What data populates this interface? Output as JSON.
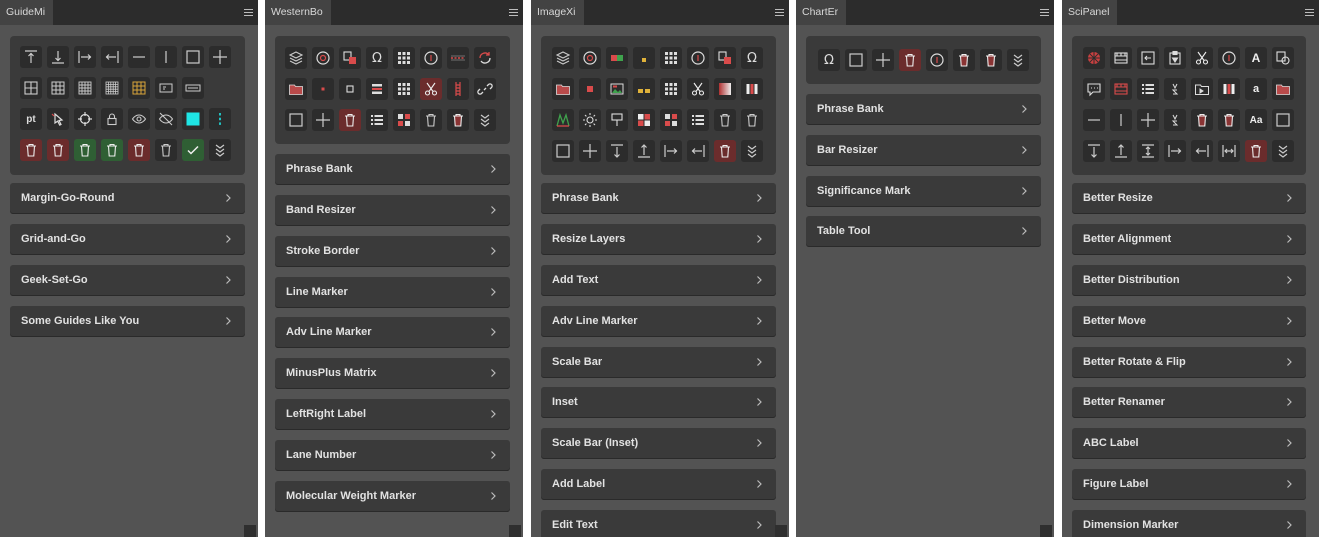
{
  "colors": {
    "panel_bg": "#535353",
    "titlebar_bg": "#2c2c2c",
    "tab_bg": "#434343",
    "button_bg": "#3a3a3a",
    "icon_bg": "#2c2c2c",
    "red_icon_bg": "#6b2c2c",
    "green_icon_bg": "#2f5f34",
    "accent_cyan": "#1fe5e5",
    "text": "#e2e2e2"
  },
  "panels": [
    {
      "tab": "GuideMi",
      "buttons": [
        "Margin-Go-Round",
        "Grid-and-Go",
        "Geek-Set-Go",
        "Some Guides Like You"
      ],
      "icons": [
        [
          "align-top-icon",
          "align-bottom-icon",
          "align-left-icon",
          "align-right-icon",
          "horizontal-line-icon",
          "vertical-line-icon",
          "square-icon",
          "plus-icon"
        ],
        [
          "grid-2x2-icon",
          "grid-3x3-icon",
          "grid-4x4-icon",
          "grid-5x5-icon",
          "grid-gold-icon",
          "grid-ratio-icon",
          "grid-ratio-wide-icon"
        ],
        [
          "pt-unit-icon",
          "cursor-icon",
          "crosshair-icon",
          "lock-icon",
          "eye-icon",
          "eye-hidden-icon",
          "cyan-square-icon",
          "cyan-dots-icon"
        ],
        [
          "trash-icon",
          "trash-icon",
          "trash-green-icon",
          "trash-green-icon",
          "trash-icon",
          "trash-icon",
          "check-icon",
          "expand-down-icon"
        ]
      ],
      "pt_label": "pt"
    },
    {
      "tab": "WesternBo",
      "buttons": [
        "Phrase Bank",
        "Band Resizer",
        "Stroke Border",
        "Line Marker",
        "Adv Line Marker",
        "MinusPlus Matrix",
        "LeftRight Label",
        "Lane Number",
        "Molecular Weight Marker"
      ],
      "icons": [
        [
          "layers-icon",
          "target-icon",
          "copy-red-icon",
          "omega-icon",
          "grid-dots-icon",
          "info-icon",
          "dashed-line-icon",
          "refresh-icon"
        ],
        [
          "folder-icon",
          "red-dot-icon",
          "small-square-icon",
          "bands-icon",
          "grid-dots-icon",
          "scissors-icon",
          "ladder-icon",
          "link-icon"
        ],
        [
          "square-icon",
          "plus-icon",
          "trash-red-icon",
          "list-icon",
          "grid-red-icon",
          "trash-icon",
          "trash-icon",
          "expand-down-icon"
        ]
      ],
      "omega": "Ω"
    },
    {
      "tab": "ImageXi",
      "buttons": [
        "Phrase Bank",
        "Resize Layers",
        "Add Text",
        "Adv Line Marker",
        "Scale Bar",
        "Inset",
        "Scale Bar (Inset)",
        "Add Label",
        "Edit Text"
      ],
      "icons": [
        [
          "layers-icon",
          "target-icon",
          "red-green-icon",
          "yellow-dot-icon",
          "grid-dots-icon",
          "info-icon",
          "copy-red-icon",
          "omega-icon"
        ],
        [
          "folder-icon",
          "red-square-icon",
          "image-icon",
          "yellow-squares-icon",
          "grid-dots-icon",
          "scissors-icon",
          "gradient-icon",
          "bars-icon"
        ],
        [
          "curve-icon",
          "sun-icon",
          "paint-icon",
          "quad-color-icon",
          "grid-red-icon",
          "list-icon",
          "trash-icon",
          "trash-icon"
        ],
        [
          "square-icon",
          "plus-icon",
          "align-top-icon",
          "align-bottom-icon",
          "align-left-icon",
          "align-right-icon",
          "trash-red-icon",
          "expand-down-icon"
        ]
      ],
      "omega": "Ω"
    },
    {
      "tab": "ChartEr",
      "buttons": [
        "Phrase Bank",
        "Bar Resizer",
        "Significance Mark",
        "Table Tool"
      ],
      "icons": [
        [
          "omega-icon",
          "square-icon",
          "plus-icon",
          "trash-red-icon",
          "info-icon",
          "trash-icon",
          "trash-icon",
          "expand-down-icon"
        ]
      ],
      "omega": "Ω"
    },
    {
      "tab": "SciPanel",
      "buttons": [
        "Better Resize",
        "Better Alignment",
        "Better Distribution",
        "Better Move",
        "Better Rotate & Flip",
        "Better Renamer",
        "ABC Label",
        "Figure Label",
        "Dimension Marker"
      ],
      "icons": [
        [
          "color-wheel-icon",
          "film-icon",
          "import-icon",
          "clipboard-icon",
          "scissors-icon",
          "info-icon",
          "text-a-icon",
          "copy-icon"
        ],
        [
          "comment-icon",
          "film-red-icon",
          "list-icon",
          "sort-az-icon",
          "folder-image-icon",
          "bars-icon",
          "text-small-a-icon",
          "folder-icon"
        ],
        [
          "horizontal-line-icon",
          "vertical-line-icon",
          "plus-icon",
          "sort-icon",
          "trash-icon",
          "trash-icon",
          "text-aa-icon",
          "square-icon"
        ],
        [
          "align-top-icon",
          "align-bottom-icon",
          "align-vcenter-icon",
          "align-left-icon",
          "align-right-icon",
          "align-hcenter-icon",
          "trash-red-icon",
          "expand-down-icon"
        ]
      ],
      "text_a": "A",
      "text_small_a": "a",
      "text_aa": "Aa"
    }
  ]
}
